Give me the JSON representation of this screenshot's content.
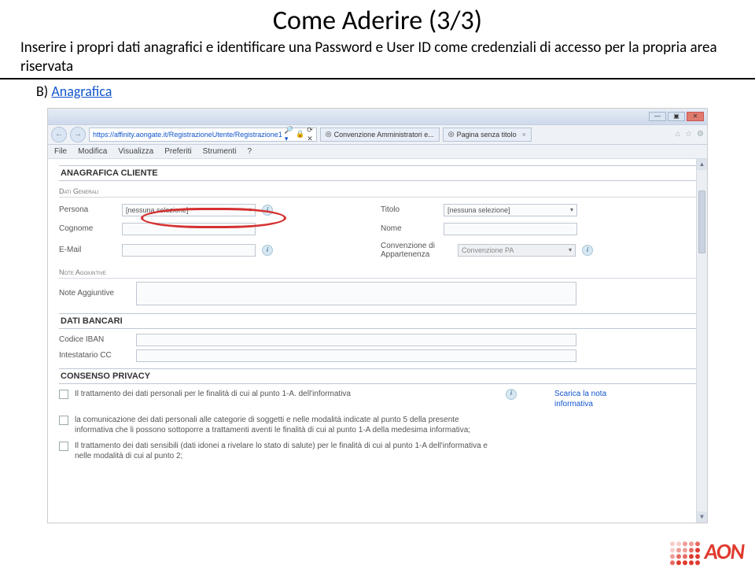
{
  "slide": {
    "title": "Come Aderire (3/3)",
    "intro": "Inserire i propri dati anagrafici e identificare una Password e User ID come credenziali di accesso per la propria area riservata",
    "sub_prefix": "B) ",
    "sub_link": "Anagrafica"
  },
  "browser": {
    "url": "https://affinity.aongate.it/RegistrazioneUtente/Registrazione1",
    "url_suffix_icons": "🔒",
    "url_caption": "⟳ ✕",
    "search_hint_lock": "🔒",
    "search_icon": "🔍",
    "tab1": "Convenzione Amministratori e...",
    "tab2": "Pagina senza titolo",
    "tab2_x": "×",
    "menu": {
      "file": "File",
      "modifica": "Modifica",
      "visualizza": "Visualizza",
      "preferiti": "Preferiti",
      "strumenti": "Strumenti",
      "help": "?"
    },
    "winbtns": {
      "min": "—",
      "max": "▣",
      "close": "✕"
    },
    "topicons": {
      "home": "⌂",
      "star": "☆",
      "gear": "⚙"
    },
    "nav": {
      "back": "←",
      "fwd": "→"
    },
    "scroll": {
      "up": "▲",
      "down": "▼"
    }
  },
  "form": {
    "section_main": "ANAGRAFICA CLIENTE",
    "sub_generali": "Dati Generali",
    "persona_lbl": "Persona",
    "persona_val": "[nessuna selezione]",
    "titolo_lbl": "Titolo",
    "titolo_val": "[nessuna selezione]",
    "cognome_lbl": "Cognome",
    "nome_lbl": "Nome",
    "email_lbl": "E-Mail",
    "conv_lbl": "Convenzione di Appartenenza",
    "conv_val": "Convenzione PA",
    "sub_note": "Note Aggiuntive",
    "note_lbl": "Note Aggiuntive",
    "section_bank": "DATI BANCARI",
    "iban_lbl": "Codice IBAN",
    "intest_lbl": "Intestatario CC",
    "section_priv": "CONSENSO PRIVACY",
    "priv1": "Il trattamento dei dati personali per le finalità di cui al punto 1-A. dell'informativa",
    "priv_link": "Scarica la nota informativa",
    "priv2": "la comunicazione dei dati personali alle categorie di soggetti e nelle modalità indicate al punto 5 della presente informativa che li possono sottoporre a trattamenti aventi le finalità di cui al punto 1-A della medesima informativa;",
    "priv3": "Il trattamento dei dati sensibili (dati idonei a rivelare lo stato di salute) per le finalità di cui al punto 1-A dell'informativa e nelle modalità di cui al punto 2;"
  },
  "logo": {
    "text": "AON"
  }
}
